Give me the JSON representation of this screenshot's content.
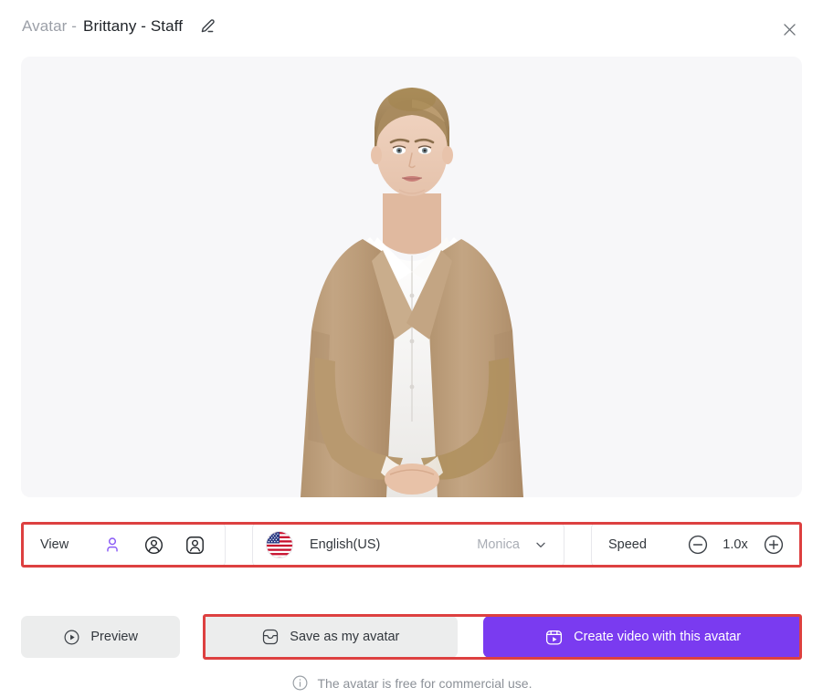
{
  "header": {
    "title_prefix": "Avatar -",
    "title_name": "Brittany - Staff",
    "edit_icon": "pencil-icon",
    "close_icon": "close-icon"
  },
  "preview": {
    "avatar_alt": "Brittany - Staff avatar, woman in tan blazer over white shirt",
    "background_color": "#f7f7f9"
  },
  "controls": {
    "view": {
      "label": "View",
      "options": [
        {
          "icon": "person-plain-icon",
          "selected": true
        },
        {
          "icon": "person-circle-icon",
          "selected": false
        },
        {
          "icon": "person-square-icon",
          "selected": false
        }
      ],
      "selected_color": "#8b5cf6"
    },
    "language": {
      "flag_icon": "us-flag-icon",
      "language": "English(US)",
      "voice": "Monica",
      "chevron_icon": "chevron-down-icon"
    },
    "speed": {
      "label": "Speed",
      "decrement_icon": "minus-circle-icon",
      "value": "1.0x",
      "increment_icon": "plus-circle-icon"
    }
  },
  "actions": {
    "preview": {
      "label": "Preview",
      "icon": "play-circle-icon"
    },
    "save": {
      "label": "Save as my avatar",
      "icon": "inbox-icon"
    },
    "create": {
      "label": "Create video with this avatar",
      "icon": "video-frame-icon",
      "color": "#7a3bf0"
    }
  },
  "footer": {
    "icon": "info-circle-icon",
    "text": "The avatar is free for commercial use."
  },
  "annotations": {
    "highlight_color": "#dd4040",
    "regions": [
      "controls-bar",
      "save-and-create-buttons"
    ]
  }
}
